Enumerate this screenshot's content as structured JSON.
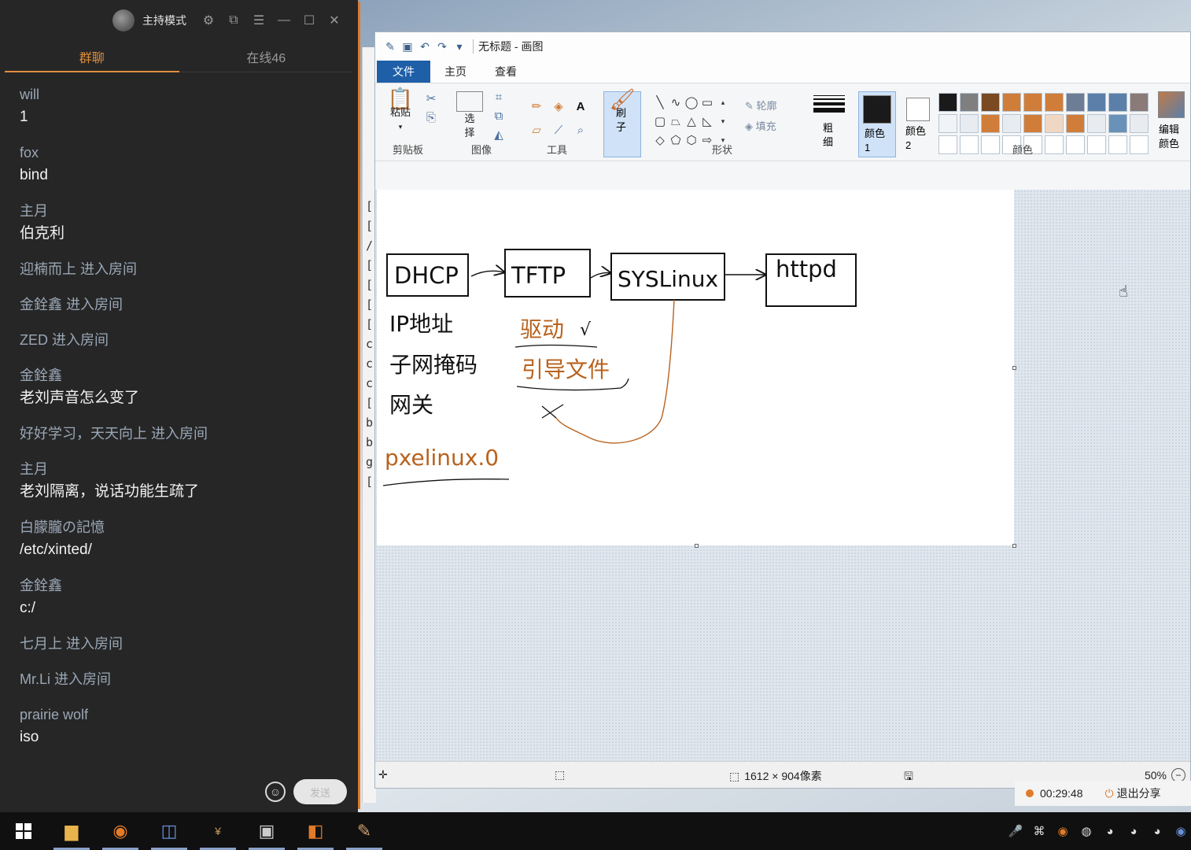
{
  "chat": {
    "host_label": "主持模式",
    "tabs": [
      {
        "label": "群聊",
        "active": true
      },
      {
        "label": "在线46",
        "active": false
      }
    ],
    "messages": [
      {
        "type": "msg",
        "sender": "will",
        "text": "1"
      },
      {
        "type": "msg",
        "sender": "fox",
        "text": "bind"
      },
      {
        "type": "msg",
        "sender": "主月",
        "text": "伯克利"
      },
      {
        "type": "sys",
        "text": "迎楠而上 进入房间"
      },
      {
        "type": "sys",
        "text": "金銓鑫      进入房间"
      },
      {
        "type": "sys",
        "text": "ZED 进入房间"
      },
      {
        "type": "msg",
        "sender": "金銓鑫",
        "text": "老刘声音怎么变了"
      },
      {
        "type": "sys",
        "text": "好好学习，天天向上 进入房间"
      },
      {
        "type": "msg",
        "sender": "主月",
        "text": "老刘隔离，说话功能生疏了"
      },
      {
        "type": "msg",
        "sender": "白朦朧の記憶",
        "text": "/etc/xinted/"
      },
      {
        "type": "msg",
        "sender": "金銓鑫",
        "text": "c:/"
      },
      {
        "type": "sys",
        "text": "七月上 进入房间"
      },
      {
        "type": "sys",
        "text": "Mr.Li 进入房间"
      },
      {
        "type": "msg",
        "sender": "prairie wolf",
        "text": "iso"
      }
    ],
    "send_label": "发送"
  },
  "bg_window_chars": [
    "[",
    "[",
    "/",
    "[",
    "[",
    "[",
    "[",
    "c",
    "c",
    "c",
    "[",
    "b",
    "b",
    "g",
    "["
  ],
  "paint": {
    "title": "无标题 - 画图",
    "tabs": {
      "file": "文件",
      "home": "主页",
      "view": "查看"
    },
    "groups": {
      "clipboard": "剪贴板",
      "image": "图像",
      "tools": "工具",
      "shapes": "形状",
      "colors": "颜色"
    },
    "buttons": {
      "paste": "粘贴",
      "select": "选择",
      "brush": "刷子",
      "outline": "轮廓",
      "fill": "填充",
      "size": "粗细",
      "color1": "颜色 1",
      "color2": "颜色 2",
      "edit_colors": "编辑颜色"
    },
    "palette": [
      "#1a1a1a",
      "#7f7f7f",
      "#7a4a22",
      "#d07d3a",
      "#d07d3a",
      "#d07d3a",
      "#6d7d96",
      "#5b7fa8",
      "#5b7fa8",
      "#8a7a78",
      "#f0f3f7",
      "#e8ecf1",
      "#d07d3a",
      "#e8ecf1",
      "#d07d3a",
      "#f0d7c4",
      "#d07d3a",
      "#e8ecf1",
      "#6a92b8",
      "#e8ecf1",
      "#ffffff",
      "#ffffff",
      "#ffffff",
      "#ffffff",
      "#ffffff",
      "#ffffff",
      "#ffffff",
      "#ffffff",
      "#ffffff",
      "#ffffff"
    ],
    "color1": "#1a1a1a",
    "color2": "#ffffff",
    "canvas": {
      "boxes": [
        "DHCP",
        "TFTP",
        "SYSLinux",
        "httpd"
      ],
      "dhcp_items": [
        "IP地址",
        "子网掩码",
        "网关"
      ],
      "tftp_items": [
        "驱动",
        "引导文件"
      ],
      "checkmark": "√",
      "filename": "pxelinux.0"
    },
    "status": {
      "dimensions": "1612 × 904像素",
      "zoom": "50%"
    }
  },
  "share": {
    "timer": "00:29:48",
    "quit_label": "退出分享"
  }
}
